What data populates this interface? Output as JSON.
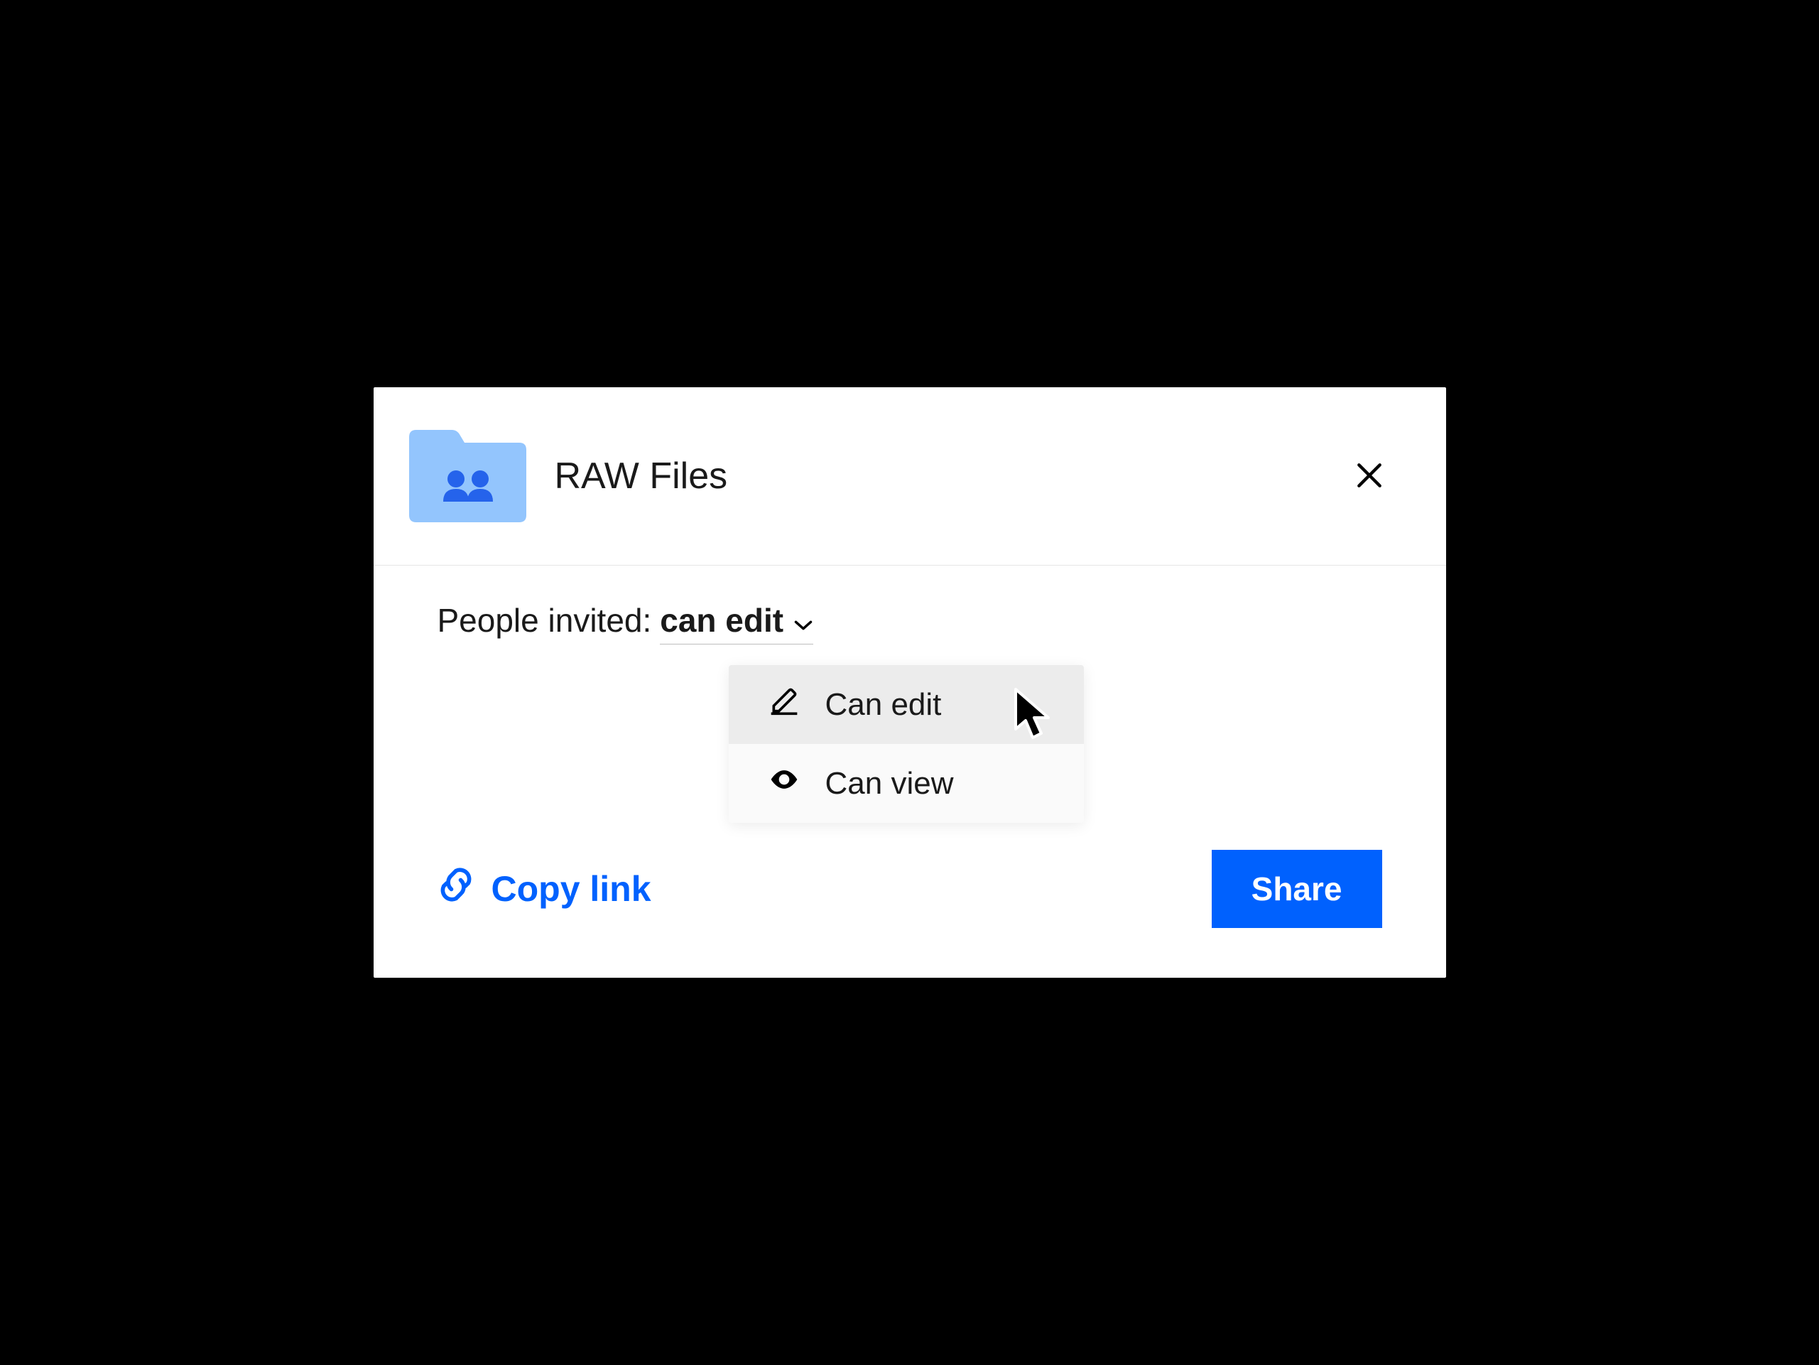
{
  "dialog": {
    "title": "RAW Files"
  },
  "permission": {
    "label": "People invited:",
    "selected": "can edit",
    "options": [
      {
        "label": "Can edit"
      },
      {
        "label": "Can view"
      }
    ]
  },
  "footer": {
    "copy_link_label": "Copy link",
    "share_label": "Share"
  },
  "colors": {
    "accent": "#0061fe",
    "folder_tint": "#93c5fd"
  }
}
